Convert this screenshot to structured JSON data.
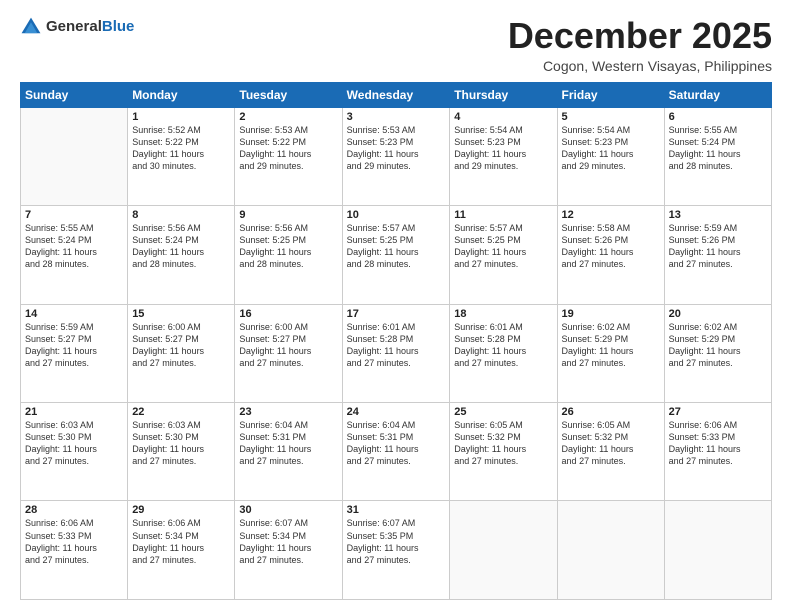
{
  "header": {
    "logo_general": "General",
    "logo_blue": "Blue",
    "title": "December 2025",
    "location": "Cogon, Western Visayas, Philippines"
  },
  "days_of_week": [
    "Sunday",
    "Monday",
    "Tuesday",
    "Wednesday",
    "Thursday",
    "Friday",
    "Saturday"
  ],
  "weeks": [
    [
      {
        "day": "",
        "content": ""
      },
      {
        "day": "1",
        "content": "Sunrise: 5:52 AM\nSunset: 5:22 PM\nDaylight: 11 hours\nand 30 minutes."
      },
      {
        "day": "2",
        "content": "Sunrise: 5:53 AM\nSunset: 5:22 PM\nDaylight: 11 hours\nand 29 minutes."
      },
      {
        "day": "3",
        "content": "Sunrise: 5:53 AM\nSunset: 5:23 PM\nDaylight: 11 hours\nand 29 minutes."
      },
      {
        "day": "4",
        "content": "Sunrise: 5:54 AM\nSunset: 5:23 PM\nDaylight: 11 hours\nand 29 minutes."
      },
      {
        "day": "5",
        "content": "Sunrise: 5:54 AM\nSunset: 5:23 PM\nDaylight: 11 hours\nand 29 minutes."
      },
      {
        "day": "6",
        "content": "Sunrise: 5:55 AM\nSunset: 5:24 PM\nDaylight: 11 hours\nand 28 minutes."
      }
    ],
    [
      {
        "day": "7",
        "content": "Sunrise: 5:55 AM\nSunset: 5:24 PM\nDaylight: 11 hours\nand 28 minutes."
      },
      {
        "day": "8",
        "content": "Sunrise: 5:56 AM\nSunset: 5:24 PM\nDaylight: 11 hours\nand 28 minutes."
      },
      {
        "day": "9",
        "content": "Sunrise: 5:56 AM\nSunset: 5:25 PM\nDaylight: 11 hours\nand 28 minutes."
      },
      {
        "day": "10",
        "content": "Sunrise: 5:57 AM\nSunset: 5:25 PM\nDaylight: 11 hours\nand 28 minutes."
      },
      {
        "day": "11",
        "content": "Sunrise: 5:57 AM\nSunset: 5:25 PM\nDaylight: 11 hours\nand 27 minutes."
      },
      {
        "day": "12",
        "content": "Sunrise: 5:58 AM\nSunset: 5:26 PM\nDaylight: 11 hours\nand 27 minutes."
      },
      {
        "day": "13",
        "content": "Sunrise: 5:59 AM\nSunset: 5:26 PM\nDaylight: 11 hours\nand 27 minutes."
      }
    ],
    [
      {
        "day": "14",
        "content": "Sunrise: 5:59 AM\nSunset: 5:27 PM\nDaylight: 11 hours\nand 27 minutes."
      },
      {
        "day": "15",
        "content": "Sunrise: 6:00 AM\nSunset: 5:27 PM\nDaylight: 11 hours\nand 27 minutes."
      },
      {
        "day": "16",
        "content": "Sunrise: 6:00 AM\nSunset: 5:27 PM\nDaylight: 11 hours\nand 27 minutes."
      },
      {
        "day": "17",
        "content": "Sunrise: 6:01 AM\nSunset: 5:28 PM\nDaylight: 11 hours\nand 27 minutes."
      },
      {
        "day": "18",
        "content": "Sunrise: 6:01 AM\nSunset: 5:28 PM\nDaylight: 11 hours\nand 27 minutes."
      },
      {
        "day": "19",
        "content": "Sunrise: 6:02 AM\nSunset: 5:29 PM\nDaylight: 11 hours\nand 27 minutes."
      },
      {
        "day": "20",
        "content": "Sunrise: 6:02 AM\nSunset: 5:29 PM\nDaylight: 11 hours\nand 27 minutes."
      }
    ],
    [
      {
        "day": "21",
        "content": "Sunrise: 6:03 AM\nSunset: 5:30 PM\nDaylight: 11 hours\nand 27 minutes."
      },
      {
        "day": "22",
        "content": "Sunrise: 6:03 AM\nSunset: 5:30 PM\nDaylight: 11 hours\nand 27 minutes."
      },
      {
        "day": "23",
        "content": "Sunrise: 6:04 AM\nSunset: 5:31 PM\nDaylight: 11 hours\nand 27 minutes."
      },
      {
        "day": "24",
        "content": "Sunrise: 6:04 AM\nSunset: 5:31 PM\nDaylight: 11 hours\nand 27 minutes."
      },
      {
        "day": "25",
        "content": "Sunrise: 6:05 AM\nSunset: 5:32 PM\nDaylight: 11 hours\nand 27 minutes."
      },
      {
        "day": "26",
        "content": "Sunrise: 6:05 AM\nSunset: 5:32 PM\nDaylight: 11 hours\nand 27 minutes."
      },
      {
        "day": "27",
        "content": "Sunrise: 6:06 AM\nSunset: 5:33 PM\nDaylight: 11 hours\nand 27 minutes."
      }
    ],
    [
      {
        "day": "28",
        "content": "Sunrise: 6:06 AM\nSunset: 5:33 PM\nDaylight: 11 hours\nand 27 minutes."
      },
      {
        "day": "29",
        "content": "Sunrise: 6:06 AM\nSunset: 5:34 PM\nDaylight: 11 hours\nand 27 minutes."
      },
      {
        "day": "30",
        "content": "Sunrise: 6:07 AM\nSunset: 5:34 PM\nDaylight: 11 hours\nand 27 minutes."
      },
      {
        "day": "31",
        "content": "Sunrise: 6:07 AM\nSunset: 5:35 PM\nDaylight: 11 hours\nand 27 minutes."
      },
      {
        "day": "",
        "content": ""
      },
      {
        "day": "",
        "content": ""
      },
      {
        "day": "",
        "content": ""
      }
    ]
  ]
}
